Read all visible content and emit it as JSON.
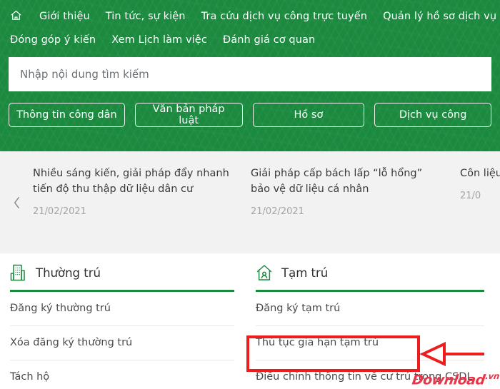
{
  "theme": {
    "brand_green": "#1b8a3f",
    "annotation_red": "#ee1c1c",
    "watermark_red": "#e8354a",
    "carousel_bg": "#f2f2f2"
  },
  "nav": {
    "home_icon": "home-icon",
    "row1": [
      {
        "label": "Giới thiệu"
      },
      {
        "label": "Tin tức, sự kiện"
      },
      {
        "label": "Tra cứu dịch vụ công trực tuyến"
      },
      {
        "label": "Quản lý hồ sơ dịch vụ công"
      }
    ],
    "row2": [
      {
        "label": "Đóng góp ý kiến"
      },
      {
        "label": "Xem Lịch làm việc"
      },
      {
        "label": "Đánh giá cơ quan"
      }
    ]
  },
  "search": {
    "placeholder": "Nhập nội dung tìm kiếm",
    "value": "",
    "icon": "search-icon"
  },
  "quick_buttons": [
    {
      "label": "Thông tin công dân"
    },
    {
      "label": "Văn bản pháp luật"
    },
    {
      "label": "Hồ sơ"
    },
    {
      "label": "Dịch vụ công"
    }
  ],
  "carousel": {
    "prev_icon": "chevron-left-icon",
    "cards": [
      {
        "title": "Nhiều sáng kiến, giải pháp đẩy nhanh tiến độ thu thập dữ liệu dân cư",
        "date": "21/02/2021"
      },
      {
        "title": "Giải pháp cấp bách lấp “lỗ hổng” bảo vệ dữ liệu cá nhân",
        "date": "21/02/2021"
      },
      {
        "title": "Côn liệu rút ",
        "date": "21/0"
      }
    ]
  },
  "services": {
    "columns": [
      {
        "icon": "building-icon",
        "title": "Thường trú",
        "items": [
          {
            "label": "Đăng ký thường trú"
          },
          {
            "label": "Xóa đăng ký thường trú"
          },
          {
            "label": "Tách hộ"
          }
        ]
      },
      {
        "icon": "house-person-icon",
        "title": "Tạm trú",
        "items": [
          {
            "label": "Đăng ký tạm trú"
          },
          {
            "label": "Thủ tục gia hạn tạm trú"
          },
          {
            "label": "Điều chỉnh thông tin về cư trú trong CSDL"
          }
        ]
      }
    ]
  },
  "annotations": {
    "highlight_target": "Thủ tục gia hạn tạm trú",
    "arrow_direction": "left"
  },
  "watermark": {
    "text": "Download",
    "suffix": ".vn"
  }
}
